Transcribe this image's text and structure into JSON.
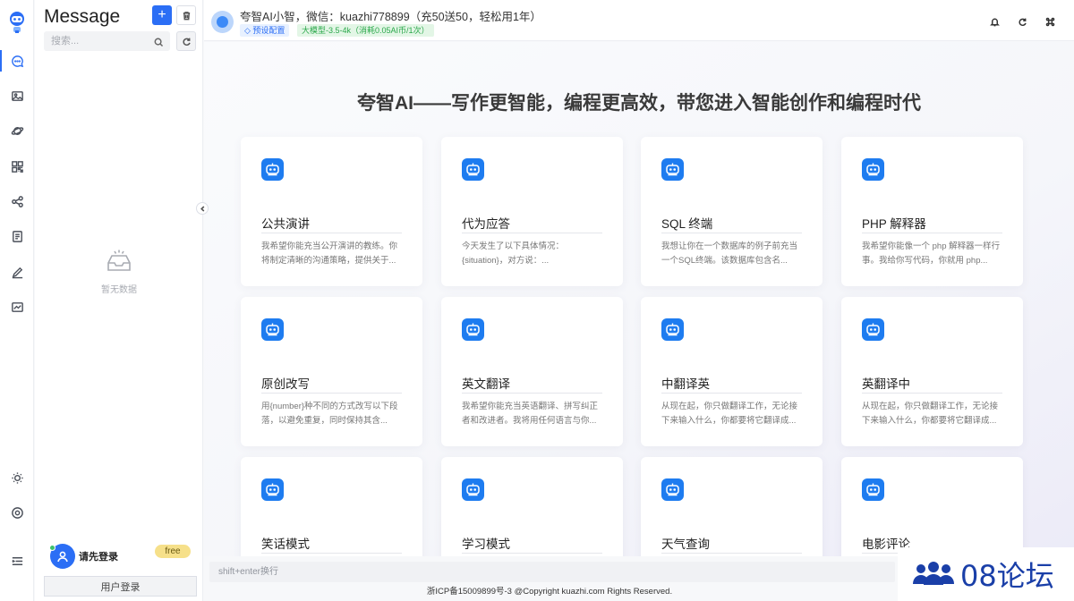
{
  "sidebar": {
    "icons": [
      "robot-logo-icon",
      "chat-icon",
      "image-icon",
      "planet-icon",
      "apps-icon",
      "share-icon",
      "document-icon",
      "edit-icon",
      "chart-icon",
      "sun-icon",
      "settings-icon",
      "menu-icon"
    ]
  },
  "panel": {
    "title": "Message",
    "search_placeholder": "搜索...",
    "empty_text": "暂无数据",
    "user_name": "请先登录",
    "badge": "free",
    "login_button": "用户登录"
  },
  "header": {
    "title": "夸智AI小智，微信：kuazhi778899（充50送50，轻松用1年）",
    "preset_tag": "◇ 预设配置",
    "model_tag": "大模型-3.5-4k（消耗0.05AI币/1次）"
  },
  "main": {
    "hero": "夸智AI——写作更智能，编程更高效，带您进入智能创作和编程时代",
    "cards": [
      {
        "title": "公共演讲",
        "desc": "我希望你能充当公开演讲的教练。你将制定清晰的沟通策略，提供关于..."
      },
      {
        "title": "代为应答",
        "desc": "今天发生了以下具体情况：{situation}，对方说：..."
      },
      {
        "title": "SQL 终端",
        "desc": "我想让你在一个数据库的例子前充当一个SQL终端。该数据库包含名..."
      },
      {
        "title": "PHP 解释器",
        "desc": "我希望你能像一个 php 解释器一样行事。我给你写代码，你就用 php..."
      },
      {
        "title": "原创改写",
        "desc": "用{number}种不同的方式改写以下段落，以避免重复，同时保持其含..."
      },
      {
        "title": "英文翻译",
        "desc": "我希望你能充当英语翻译、拼写纠正者和改进者。我将用任何语言与你..."
      },
      {
        "title": "中翻译英",
        "desc": "从现在起，你只做翻译工作，无论接下来输入什么，你都要将它翻译成..."
      },
      {
        "title": "英翻译中",
        "desc": "从现在起，你只做翻译工作，无论接下来输入什么，你都要将它翻译成..."
      },
      {
        "title": "笑话模式",
        "desc": ""
      },
      {
        "title": "学习模式",
        "desc": ""
      },
      {
        "title": "天气查询",
        "desc": ""
      },
      {
        "title": "电影评论",
        "desc": ""
      }
    ]
  },
  "input": {
    "placeholder": "shift+enter换行"
  },
  "footer": {
    "text": "浙ICP备15009899号-3 @Copyright kuazhi.com Rights Reserved."
  },
  "watermark": {
    "text": "08论坛"
  },
  "colors": {
    "accent": "#2b6ef5",
    "card_icon": "#1e7cf0",
    "badge": "#f6e08a"
  }
}
